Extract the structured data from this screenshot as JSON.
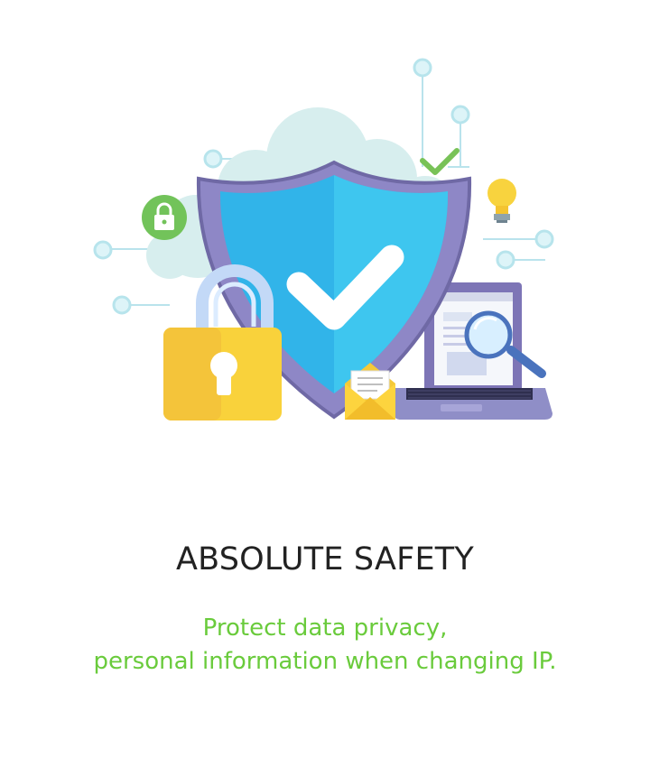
{
  "feature": {
    "title": "ABSOLUTE SAFETY",
    "description_lines": [
      "Protect data privacy,",
      "personal information when changing IP."
    ]
  },
  "colors": {
    "title": "#222222",
    "description": "#6acb3c",
    "shield": "#32b7ea",
    "lock": "#f6c743",
    "laptop": "#8f8ec7",
    "cloud": "#d8efef"
  },
  "icons": [
    "cloud-icon",
    "shield-check-icon",
    "padlock-icon",
    "laptop-icon",
    "magnifier-icon",
    "envelope-icon",
    "lightbulb-icon",
    "check-icon",
    "small-lock-icon"
  ]
}
